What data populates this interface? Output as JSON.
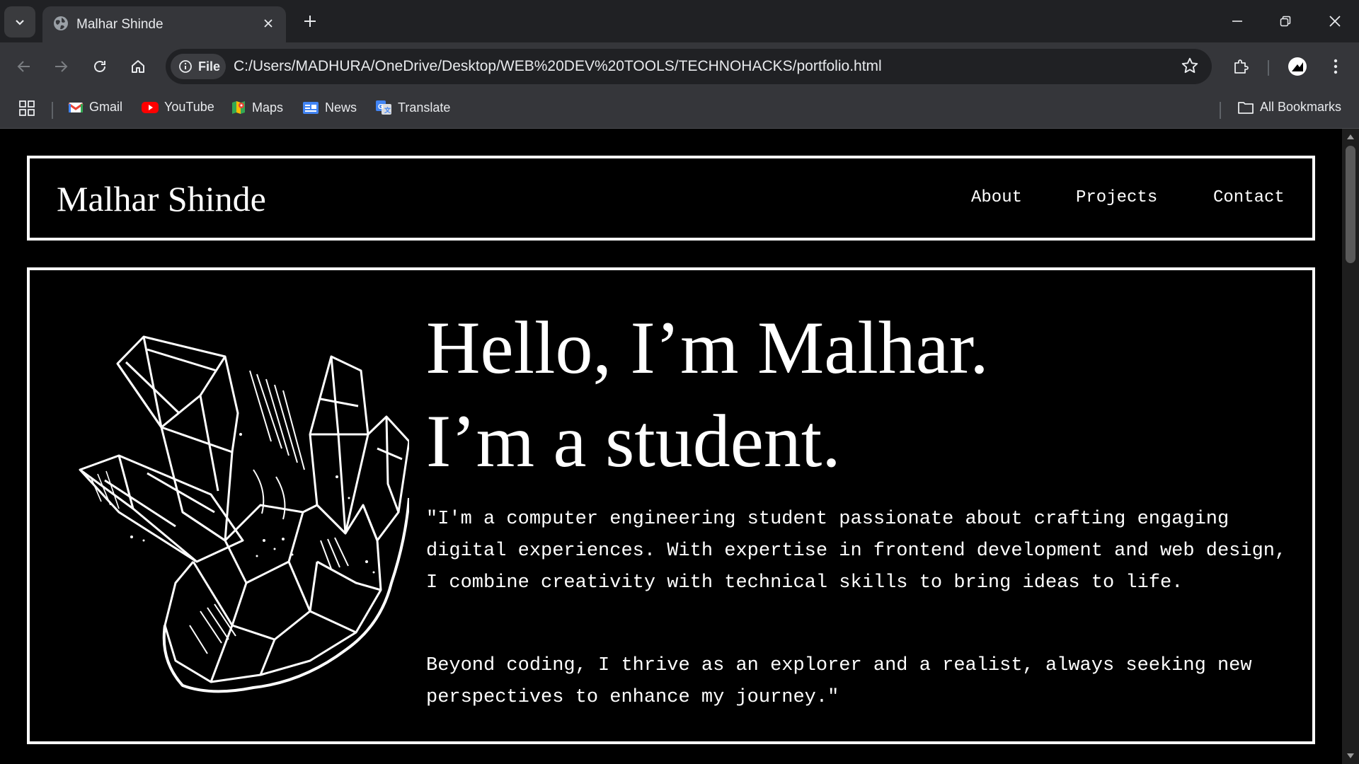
{
  "browser": {
    "tab_title": "Malhar Shinde",
    "url_chip": "File",
    "url": "C:/Users/MADHURA/OneDrive/Desktop/WEB%20DEV%20TOOLS/TECHNOHACKS/portfolio.html",
    "bookmarks": [
      {
        "label": "Gmail",
        "icon": "gmail-icon"
      },
      {
        "label": "YouTube",
        "icon": "youtube-icon"
      },
      {
        "label": "Maps",
        "icon": "maps-icon"
      },
      {
        "label": "News",
        "icon": "news-icon"
      },
      {
        "label": "Translate",
        "icon": "translate-icon"
      }
    ],
    "all_bookmarks": "All Bookmarks"
  },
  "page": {
    "brand": "Malhar Shinde",
    "nav": [
      {
        "label": "About"
      },
      {
        "label": "Projects"
      },
      {
        "label": "Contact"
      }
    ],
    "hero": {
      "heading_line1": "Hello, I’m Malhar.",
      "heading_line2": "I’m a student.",
      "paragraph1": "\"I'm a computer engineering student passionate about crafting engaging digital experiences. With expertise in frontend development and web design, I combine creativity with technical skills to bring ideas to life.",
      "paragraph2": "Beyond coding, I thrive as an explorer and a realist, always seeking new perspectives to enhance my journey.\""
    }
  },
  "colors": {
    "page_bg": "#000000",
    "page_fg": "#ffffff",
    "chrome_dark": "#202124",
    "chrome_mid": "#35363a"
  }
}
